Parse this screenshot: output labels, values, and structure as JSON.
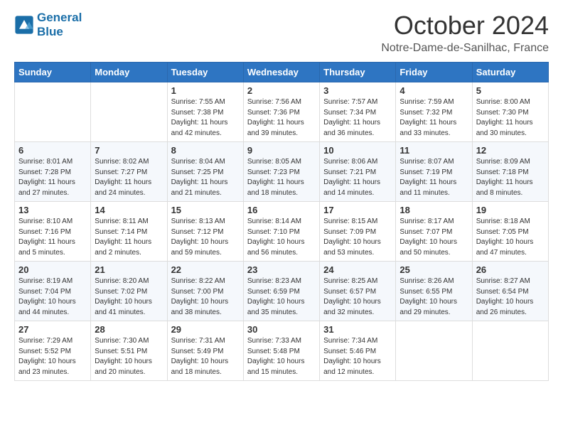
{
  "header": {
    "logo_line1": "General",
    "logo_line2": "Blue",
    "month_title": "October 2024",
    "location": "Notre-Dame-de-Sanilhac, France"
  },
  "weekdays": [
    "Sunday",
    "Monday",
    "Tuesday",
    "Wednesday",
    "Thursday",
    "Friday",
    "Saturday"
  ],
  "weeks": [
    [
      {
        "day": "",
        "info": ""
      },
      {
        "day": "",
        "info": ""
      },
      {
        "day": "1",
        "info": "Sunrise: 7:55 AM\nSunset: 7:38 PM\nDaylight: 11 hours and 42 minutes."
      },
      {
        "day": "2",
        "info": "Sunrise: 7:56 AM\nSunset: 7:36 PM\nDaylight: 11 hours and 39 minutes."
      },
      {
        "day": "3",
        "info": "Sunrise: 7:57 AM\nSunset: 7:34 PM\nDaylight: 11 hours and 36 minutes."
      },
      {
        "day": "4",
        "info": "Sunrise: 7:59 AM\nSunset: 7:32 PM\nDaylight: 11 hours and 33 minutes."
      },
      {
        "day": "5",
        "info": "Sunrise: 8:00 AM\nSunset: 7:30 PM\nDaylight: 11 hours and 30 minutes."
      }
    ],
    [
      {
        "day": "6",
        "info": "Sunrise: 8:01 AM\nSunset: 7:28 PM\nDaylight: 11 hours and 27 minutes."
      },
      {
        "day": "7",
        "info": "Sunrise: 8:02 AM\nSunset: 7:27 PM\nDaylight: 11 hours and 24 minutes."
      },
      {
        "day": "8",
        "info": "Sunrise: 8:04 AM\nSunset: 7:25 PM\nDaylight: 11 hours and 21 minutes."
      },
      {
        "day": "9",
        "info": "Sunrise: 8:05 AM\nSunset: 7:23 PM\nDaylight: 11 hours and 18 minutes."
      },
      {
        "day": "10",
        "info": "Sunrise: 8:06 AM\nSunset: 7:21 PM\nDaylight: 11 hours and 14 minutes."
      },
      {
        "day": "11",
        "info": "Sunrise: 8:07 AM\nSunset: 7:19 PM\nDaylight: 11 hours and 11 minutes."
      },
      {
        "day": "12",
        "info": "Sunrise: 8:09 AM\nSunset: 7:18 PM\nDaylight: 11 hours and 8 minutes."
      }
    ],
    [
      {
        "day": "13",
        "info": "Sunrise: 8:10 AM\nSunset: 7:16 PM\nDaylight: 11 hours and 5 minutes."
      },
      {
        "day": "14",
        "info": "Sunrise: 8:11 AM\nSunset: 7:14 PM\nDaylight: 11 hours and 2 minutes."
      },
      {
        "day": "15",
        "info": "Sunrise: 8:13 AM\nSunset: 7:12 PM\nDaylight: 10 hours and 59 minutes."
      },
      {
        "day": "16",
        "info": "Sunrise: 8:14 AM\nSunset: 7:10 PM\nDaylight: 10 hours and 56 minutes."
      },
      {
        "day": "17",
        "info": "Sunrise: 8:15 AM\nSunset: 7:09 PM\nDaylight: 10 hours and 53 minutes."
      },
      {
        "day": "18",
        "info": "Sunrise: 8:17 AM\nSunset: 7:07 PM\nDaylight: 10 hours and 50 minutes."
      },
      {
        "day": "19",
        "info": "Sunrise: 8:18 AM\nSunset: 7:05 PM\nDaylight: 10 hours and 47 minutes."
      }
    ],
    [
      {
        "day": "20",
        "info": "Sunrise: 8:19 AM\nSunset: 7:04 PM\nDaylight: 10 hours and 44 minutes."
      },
      {
        "day": "21",
        "info": "Sunrise: 8:20 AM\nSunset: 7:02 PM\nDaylight: 10 hours and 41 minutes."
      },
      {
        "day": "22",
        "info": "Sunrise: 8:22 AM\nSunset: 7:00 PM\nDaylight: 10 hours and 38 minutes."
      },
      {
        "day": "23",
        "info": "Sunrise: 8:23 AM\nSunset: 6:59 PM\nDaylight: 10 hours and 35 minutes."
      },
      {
        "day": "24",
        "info": "Sunrise: 8:25 AM\nSunset: 6:57 PM\nDaylight: 10 hours and 32 minutes."
      },
      {
        "day": "25",
        "info": "Sunrise: 8:26 AM\nSunset: 6:55 PM\nDaylight: 10 hours and 29 minutes."
      },
      {
        "day": "26",
        "info": "Sunrise: 8:27 AM\nSunset: 6:54 PM\nDaylight: 10 hours and 26 minutes."
      }
    ],
    [
      {
        "day": "27",
        "info": "Sunrise: 7:29 AM\nSunset: 5:52 PM\nDaylight: 10 hours and 23 minutes."
      },
      {
        "day": "28",
        "info": "Sunrise: 7:30 AM\nSunset: 5:51 PM\nDaylight: 10 hours and 20 minutes."
      },
      {
        "day": "29",
        "info": "Sunrise: 7:31 AM\nSunset: 5:49 PM\nDaylight: 10 hours and 18 minutes."
      },
      {
        "day": "30",
        "info": "Sunrise: 7:33 AM\nSunset: 5:48 PM\nDaylight: 10 hours and 15 minutes."
      },
      {
        "day": "31",
        "info": "Sunrise: 7:34 AM\nSunset: 5:46 PM\nDaylight: 10 hours and 12 minutes."
      },
      {
        "day": "",
        "info": ""
      },
      {
        "day": "",
        "info": ""
      }
    ]
  ]
}
